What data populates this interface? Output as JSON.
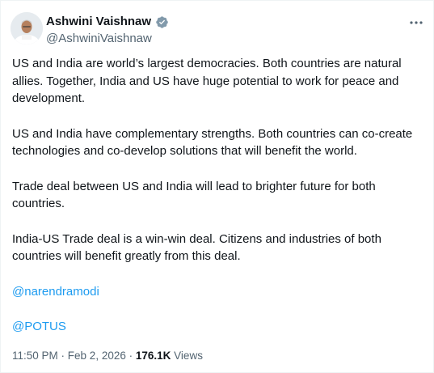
{
  "author": {
    "display_name": "Ashwini Vaishnaw",
    "handle": "@AshwiniVaishnaw",
    "verified": true,
    "avatar": "profile-photo"
  },
  "menu_icon": "more-horizontal-icon",
  "paragraphs": [
    "US and India are world’s largest democracies. Both countries are natural allies. Together, India and US have huge potential to work for peace and development.",
    "US and India have complementary strengths. Both countries can co-create technologies and co-develop solutions that will benefit the world.",
    "Trade deal between US and India will lead to brighter future for both countries.",
    "India-US Trade deal is a win-win deal. Citizens and industries of both countries will benefit greatly from this deal."
  ],
  "mentions": [
    "@narendramodi",
    "@POTUS"
  ],
  "meta": {
    "time": "11:50 PM",
    "separator": " · ",
    "date": "Feb 2, 2026",
    "views_count": "176.1K",
    "views_label": "Views"
  },
  "colors": {
    "link": "#1d9bf0",
    "secondary_text": "#536471",
    "primary_text": "#0f1419",
    "verified_badge": "#829aab"
  }
}
